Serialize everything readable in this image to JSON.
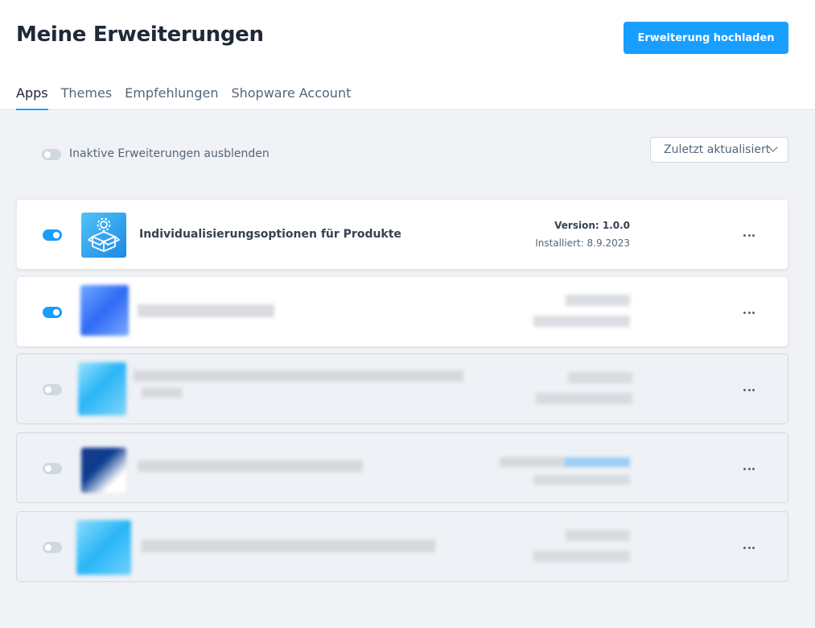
{
  "page": {
    "title": "Meine Erweiterungen",
    "upload_label": "Erweiterung hochladen"
  },
  "tabs": [
    {
      "label": "Apps",
      "active": true
    },
    {
      "label": "Themes",
      "active": false
    },
    {
      "label": "Empfehlungen",
      "active": false
    },
    {
      "label": "Shopware Account",
      "active": false
    }
  ],
  "filter": {
    "hide_inactive_label": "Inaktive Erweiterungen ausblenden",
    "hide_inactive_enabled": false,
    "sort_label": "Zuletzt aktualisiert"
  },
  "extensions": [
    {
      "name": "Individualisierungsoptionen für Produkte",
      "version": "Version: 1.0.0",
      "installed": "Installiert: 8.9.2023",
      "active": true,
      "icon": "gear-box-icon",
      "blurred": false
    },
    {
      "name": "",
      "version": "",
      "installed": "",
      "active": true,
      "icon": "pixelated-logo",
      "blurred": true
    },
    {
      "name": "",
      "version": "",
      "installed": "",
      "active": false,
      "icon": "pixelated-logo",
      "blurred": true
    },
    {
      "name": "",
      "version": "",
      "installed": "",
      "active": false,
      "icon": "pixelated-logo",
      "blurred": true
    },
    {
      "name": "",
      "version": "",
      "installed": "",
      "active": false,
      "icon": "pixelated-logo",
      "blurred": true
    }
  ],
  "colors": {
    "accent": "#189eff",
    "toggle_off": "#d1d9e0",
    "background": "#f0f2f5"
  }
}
